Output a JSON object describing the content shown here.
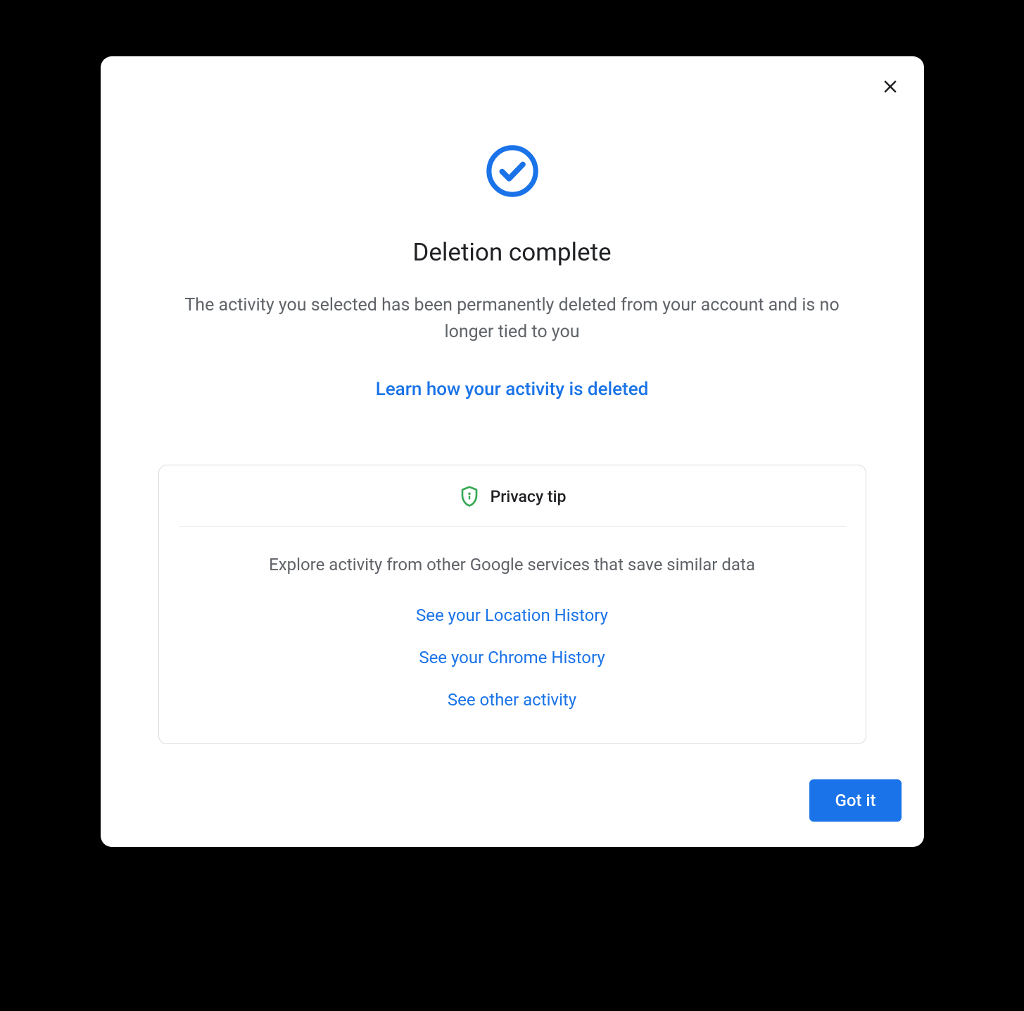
{
  "dialog": {
    "title": "Deletion complete",
    "subtitle": "The activity you selected has been permanently deleted from your account and is no longer tied to you",
    "learn_link": "Learn how your activity is deleted",
    "got_it_label": "Got it"
  },
  "privacy_tip": {
    "heading": "Privacy tip",
    "description": "Explore activity from other Google services that save similar data",
    "links": [
      "See your Location History",
      "See your Chrome History",
      "See other activity"
    ]
  },
  "colors": {
    "accent": "#1a73e8",
    "shield": "#34a853"
  }
}
